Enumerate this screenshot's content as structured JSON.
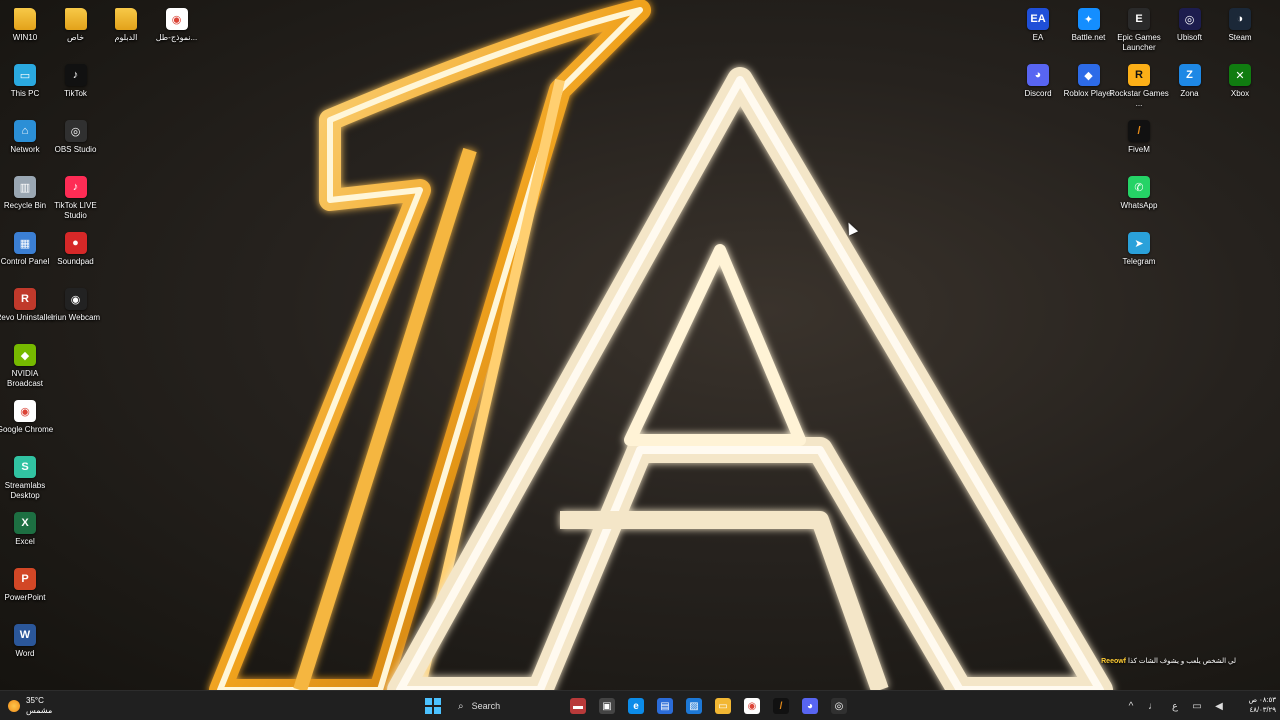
{
  "desktop_icons_left": [
    {
      "label": "WIN10",
      "type": "folder",
      "col": 0,
      "row": 0
    },
    {
      "label": "خاص",
      "type": "folder",
      "col": 1,
      "row": 0
    },
    {
      "label": "الدبلوم",
      "type": "folder",
      "col": 2,
      "row": 0
    },
    {
      "label": "نموذج-طل...",
      "type": "chrome-doc",
      "col": 3,
      "row": 0
    },
    {
      "label": "This PC",
      "type": "thispc",
      "col": 0,
      "row": 1
    },
    {
      "label": "TikTok",
      "type": "tiktok",
      "col": 1,
      "row": 1
    },
    {
      "label": "Network",
      "type": "network",
      "col": 0,
      "row": 2
    },
    {
      "label": "OBS Studio",
      "type": "obs",
      "col": 1,
      "row": 2
    },
    {
      "label": "Recycle Bin",
      "type": "recycle",
      "col": 0,
      "row": 3
    },
    {
      "label": "TikTok LIVE Studio",
      "type": "tiktoklive",
      "col": 1,
      "row": 3
    },
    {
      "label": "Control Panel",
      "type": "controlpanel",
      "col": 0,
      "row": 4
    },
    {
      "label": "Soundpad",
      "type": "soundpad",
      "col": 1,
      "row": 4
    },
    {
      "label": "Revo Uninstaller",
      "type": "revo",
      "col": 0,
      "row": 5
    },
    {
      "label": "Iriun Webcam",
      "type": "iriun",
      "col": 1,
      "row": 5
    },
    {
      "label": "NVIDIA Broadcast",
      "type": "nvidia",
      "col": 0,
      "row": 6
    },
    {
      "label": "Google Chrome",
      "type": "chrome",
      "col": 0,
      "row": 7
    },
    {
      "label": "Streamlabs Desktop",
      "type": "streamlabs",
      "col": 0,
      "row": 8
    },
    {
      "label": "Excel",
      "type": "excel",
      "col": 0,
      "row": 9
    },
    {
      "label": "PowerPoint",
      "type": "powerpoint",
      "col": 0,
      "row": 10
    },
    {
      "label": "Word",
      "type": "word",
      "col": 0,
      "row": 11
    }
  ],
  "desktop_icons_right": [
    {
      "label": "EA",
      "type": "ea",
      "col": 0,
      "row": 0
    },
    {
      "label": "Battle.net",
      "type": "battlenet",
      "col": 1,
      "row": 0
    },
    {
      "label": "Epic Games Launcher",
      "type": "epic",
      "col": 2,
      "row": 0
    },
    {
      "label": "Ubisoft",
      "type": "ubisoft",
      "col": 3,
      "row": 0
    },
    {
      "label": "Steam",
      "type": "steam",
      "col": 4,
      "row": 0
    },
    {
      "label": "Discord",
      "type": "discord",
      "col": 0,
      "row": 1
    },
    {
      "label": "Roblox Player",
      "type": "roblox",
      "col": 1,
      "row": 1
    },
    {
      "label": "Rockstar Games ...",
      "type": "rockstar",
      "col": 2,
      "row": 1
    },
    {
      "label": "Zona",
      "type": "zona",
      "col": 3,
      "row": 1
    },
    {
      "label": "Xbox",
      "type": "xbox",
      "col": 4,
      "row": 1
    },
    {
      "label": "FiveM",
      "type": "fivem",
      "col": 2,
      "row": 2
    },
    {
      "label": "WhatsApp",
      "type": "whatsapp",
      "col": 2,
      "row": 3
    },
    {
      "label": "Telegram",
      "type": "telegram",
      "col": 2,
      "row": 4
    }
  ],
  "icon_styles": {
    "folder": {
      "bg": "#f2b733",
      "glyph": ""
    },
    "chrome-doc": {
      "bg": "#ffffff",
      "glyph": "◉",
      "fg": "#db4437"
    },
    "thispc": {
      "bg": "#2aa9e0",
      "glyph": "▭"
    },
    "tiktok": {
      "bg": "#111111",
      "glyph": "♪"
    },
    "network": {
      "bg": "#2b8fd6",
      "glyph": "⌂"
    },
    "obs": {
      "bg": "#303030",
      "glyph": "◎"
    },
    "recycle": {
      "bg": "#9aa7b3",
      "glyph": "▥"
    },
    "tiktoklive": {
      "bg": "#fe2c55",
      "glyph": "♪"
    },
    "controlpanel": {
      "bg": "#3b7fd4",
      "glyph": "▦"
    },
    "soundpad": {
      "bg": "#d62828",
      "glyph": "●"
    },
    "revo": {
      "bg": "#c0392b",
      "glyph": "R"
    },
    "iriun": {
      "bg": "#222222",
      "glyph": "◉"
    },
    "nvidia": {
      "bg": "#76b900",
      "glyph": "◆"
    },
    "chrome": {
      "bg": "#ffffff",
      "glyph": "◉",
      "fg": "#db4437"
    },
    "streamlabs": {
      "bg": "#31c3a2",
      "glyph": "S"
    },
    "excel": {
      "bg": "#1d6f42",
      "glyph": "X"
    },
    "powerpoint": {
      "bg": "#d24726",
      "glyph": "P"
    },
    "word": {
      "bg": "#2b579a",
      "glyph": "W"
    },
    "ea": {
      "bg": "#1f4fd8",
      "glyph": "EA"
    },
    "battlenet": {
      "bg": "#148eff",
      "glyph": "✦"
    },
    "epic": {
      "bg": "#2a2a2a",
      "glyph": "E"
    },
    "ubisoft": {
      "bg": "#1d1d4e",
      "glyph": "◎"
    },
    "steam": {
      "bg": "#1b2838",
      "glyph": "◑"
    },
    "discord": {
      "bg": "#5865f2",
      "glyph": "◕"
    },
    "roblox": {
      "bg": "#2d6be8",
      "glyph": "◆"
    },
    "rockstar": {
      "bg": "#fcaf17",
      "glyph": "R",
      "fg": "#111111"
    },
    "zona": {
      "bg": "#1e88e5",
      "glyph": "Z"
    },
    "xbox": {
      "bg": "#107c10",
      "glyph": "✕"
    },
    "fivem": {
      "bg": "#111111",
      "glyph": "/",
      "fg": "#e38a1a"
    },
    "whatsapp": {
      "bg": "#25d366",
      "glyph": "✆"
    },
    "telegram": {
      "bg": "#2aa1da",
      "glyph": "➤"
    }
  },
  "notification": {
    "highlight": "Reeowf",
    "text": "لي الشخص يلعب و يشوف الشات كذا"
  },
  "weather": {
    "temp": "35°C",
    "condition": "مشمس"
  },
  "taskbar": {
    "search_label": "Search",
    "apps": [
      {
        "name": "racing-game",
        "bg": "#b83a3a",
        "glyph": "▬"
      },
      {
        "name": "task-view",
        "bg": "#444444",
        "glyph": "▣"
      },
      {
        "name": "edge",
        "bg": "#0c8ce9",
        "glyph": "e"
      },
      {
        "name": "store",
        "bg": "#2b6cd8",
        "glyph": "▤"
      },
      {
        "name": "photos",
        "bg": "#1d78d6",
        "glyph": "▨"
      },
      {
        "name": "file-explorer",
        "bg": "#f2b733",
        "glyph": "▭"
      },
      {
        "name": "chrome",
        "bg": "#ffffff",
        "glyph": "◉",
        "fg": "#db4437"
      },
      {
        "name": "fivem",
        "bg": "#111111",
        "glyph": "/",
        "fg": "#e38a1a"
      },
      {
        "name": "discord",
        "bg": "#5865f2",
        "glyph": "◕"
      },
      {
        "name": "obs",
        "bg": "#303030",
        "glyph": "◎"
      }
    ],
    "tray": [
      {
        "name": "chevron-up",
        "glyph": "^"
      },
      {
        "name": "microphone",
        "glyph": "♩"
      },
      {
        "name": "language",
        "glyph": "ع"
      },
      {
        "name": "network",
        "glyph": "▭"
      },
      {
        "name": "volume",
        "glyph": "◀"
      }
    ],
    "time": "٠٨:٥٣ ص",
    "date": "٤٨/٠٣/٢٩"
  }
}
